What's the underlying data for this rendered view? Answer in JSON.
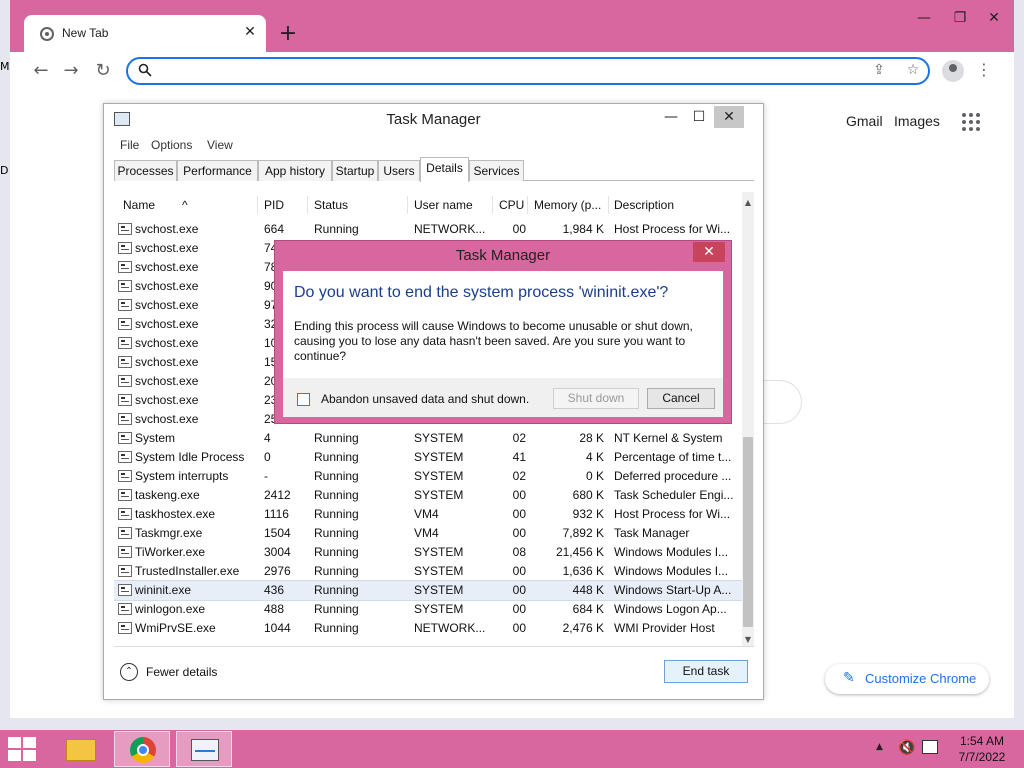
{
  "desktop": {
    "edge_labels": [
      "M",
      "D"
    ]
  },
  "browser": {
    "tab_title": "New Tab",
    "tab_close": "✕",
    "new_tab": "+",
    "window_controls": {
      "minimize": "—",
      "restore": "❐",
      "close": "✕"
    },
    "nav": {
      "back": "←",
      "forward": "→",
      "reload": "↻"
    },
    "omnibox": {
      "value": "",
      "placeholder": ""
    },
    "menu": "⋮",
    "share": "⇪",
    "bookmark": "☆",
    "links": {
      "gmail": "Gmail",
      "images": "Images"
    },
    "customize_label": "Customize Chrome",
    "customize_icon": "✎"
  },
  "task_manager": {
    "title": "Task Manager",
    "controls": {
      "minimize": "—",
      "maximize": "☐",
      "close": "✕"
    },
    "menu": [
      "File",
      "Options",
      "View"
    ],
    "tabs": [
      "Processes",
      "Performance",
      "App history",
      "Startup",
      "Users",
      "Details",
      "Services"
    ],
    "active_tab": "Details",
    "columns": [
      "Name",
      "PID",
      "Status",
      "User name",
      "CPU",
      "Memory (p...",
      "Description"
    ],
    "sort_indicator": "^",
    "rows": [
      [
        "svchost.exe",
        "664",
        "Running",
        "NETWORK...",
        "00",
        "1,984 K",
        "Host Process for Wi..."
      ],
      [
        "svchost.exe",
        "74",
        "",
        "",
        "",
        "",
        ""
      ],
      [
        "svchost.exe",
        "78",
        "",
        "",
        "",
        "",
        ""
      ],
      [
        "svchost.exe",
        "90",
        "",
        "",
        "",
        "",
        ""
      ],
      [
        "svchost.exe",
        "97",
        "",
        "",
        "",
        "",
        ""
      ],
      [
        "svchost.exe",
        "32",
        "",
        "",
        "",
        "",
        ""
      ],
      [
        "svchost.exe",
        "10",
        "",
        "",
        "",
        "",
        ""
      ],
      [
        "svchost.exe",
        "15",
        "",
        "",
        "",
        "",
        ""
      ],
      [
        "svchost.exe",
        "20",
        "",
        "",
        "",
        "",
        ""
      ],
      [
        "svchost.exe",
        "23",
        "",
        "",
        "",
        "",
        ""
      ],
      [
        "svchost.exe",
        "25",
        "",
        "",
        "",
        "",
        ""
      ],
      [
        "System",
        "4",
        "Running",
        "SYSTEM",
        "02",
        "28 K",
        "NT Kernel & System"
      ],
      [
        "System Idle Process",
        "0",
        "Running",
        "SYSTEM",
        "41",
        "4 K",
        "Percentage of time t..."
      ],
      [
        "System interrupts",
        "-",
        "Running",
        "SYSTEM",
        "02",
        "0 K",
        "Deferred procedure ..."
      ],
      [
        "taskeng.exe",
        "2412",
        "Running",
        "SYSTEM",
        "00",
        "680 K",
        "Task Scheduler Engi..."
      ],
      [
        "taskhostex.exe",
        "1116",
        "Running",
        "VM4",
        "00",
        "932 K",
        "Host Process for Wi..."
      ],
      [
        "Taskmgr.exe",
        "1504",
        "Running",
        "VM4",
        "00",
        "7,892 K",
        "Task Manager"
      ],
      [
        "TiWorker.exe",
        "3004",
        "Running",
        "SYSTEM",
        "08",
        "21,456 K",
        "Windows Modules I..."
      ],
      [
        "TrustedInstaller.exe",
        "2976",
        "Running",
        "SYSTEM",
        "00",
        "1,636 K",
        "Windows Modules I..."
      ],
      [
        "wininit.exe",
        "436",
        "Running",
        "SYSTEM",
        "00",
        "448 K",
        "Windows Start-Up A..."
      ],
      [
        "winlogon.exe",
        "488",
        "Running",
        "SYSTEM",
        "00",
        "684 K",
        "Windows Logon Ap..."
      ],
      [
        "WmiPrvSE.exe",
        "1044",
        "Running",
        "NETWORK...",
        "00",
        "2,476 K",
        "WMI Provider Host"
      ]
    ],
    "selected_row": 19,
    "fewer_details": "Fewer details",
    "fewer_icon": "⌃",
    "end_task": "End task"
  },
  "dialog": {
    "title": "Task Manager",
    "close": "✕",
    "heading": "Do you want to end the system process 'wininit.exe'?",
    "message": "Ending this process will cause Windows to become unusable or shut down, causing you to lose any data hasn't been saved. Are you sure you want to continue?",
    "checkbox_label": "Abandon unsaved data and shut down.",
    "checkbox_checked": false,
    "shutdown_label": "Shut down",
    "cancel_label": "Cancel"
  },
  "taskbar": {
    "clock_time": "1:54 AM",
    "clock_date": "7/7/2022",
    "tray_arrow": "▲",
    "volume": "🔇"
  }
}
